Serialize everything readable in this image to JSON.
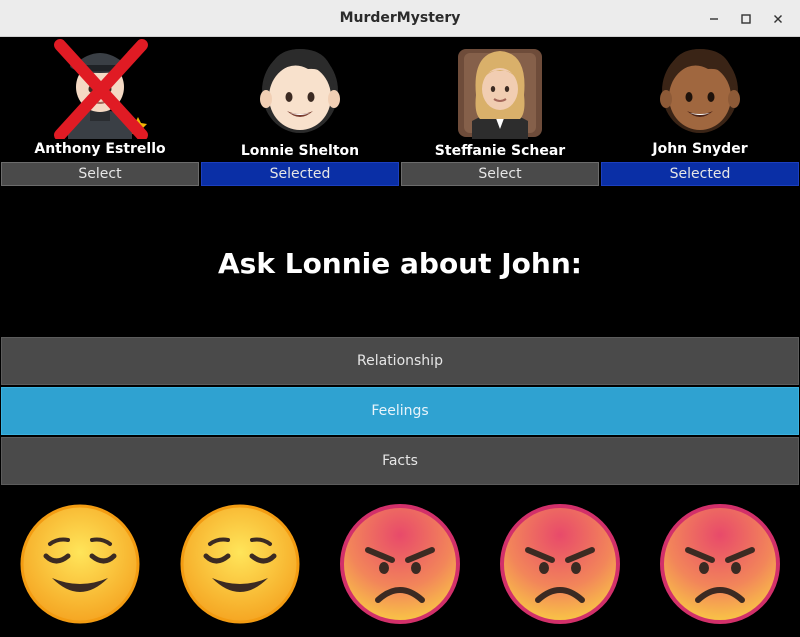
{
  "window": {
    "title": "MurderMystery"
  },
  "suspects": [
    {
      "name": "Anthony Estrello",
      "button": "Select",
      "selected": false,
      "eliminated": true
    },
    {
      "name": "Lonnie Shelton",
      "button": "Selected",
      "selected": true,
      "eliminated": false
    },
    {
      "name": "Steffanie Schear",
      "button": "Select",
      "selected": false,
      "eliminated": false
    },
    {
      "name": "John Snyder",
      "button": "Selected",
      "selected": true,
      "eliminated": false
    }
  ],
  "prompt": "Ask Lonnie about John:",
  "questions": [
    {
      "label": "Relationship",
      "active": false
    },
    {
      "label": "Feelings",
      "active": true
    },
    {
      "label": "Facts",
      "active": false
    }
  ],
  "moods": [
    "relieved",
    "relieved",
    "angry",
    "angry",
    "angry"
  ],
  "colors": {
    "selected_button": "#0a2fa6",
    "active_question": "#2fa2d1",
    "default_button": "#4a4a4a",
    "background": "#000000",
    "eliminated_cross": "#e01b24"
  }
}
